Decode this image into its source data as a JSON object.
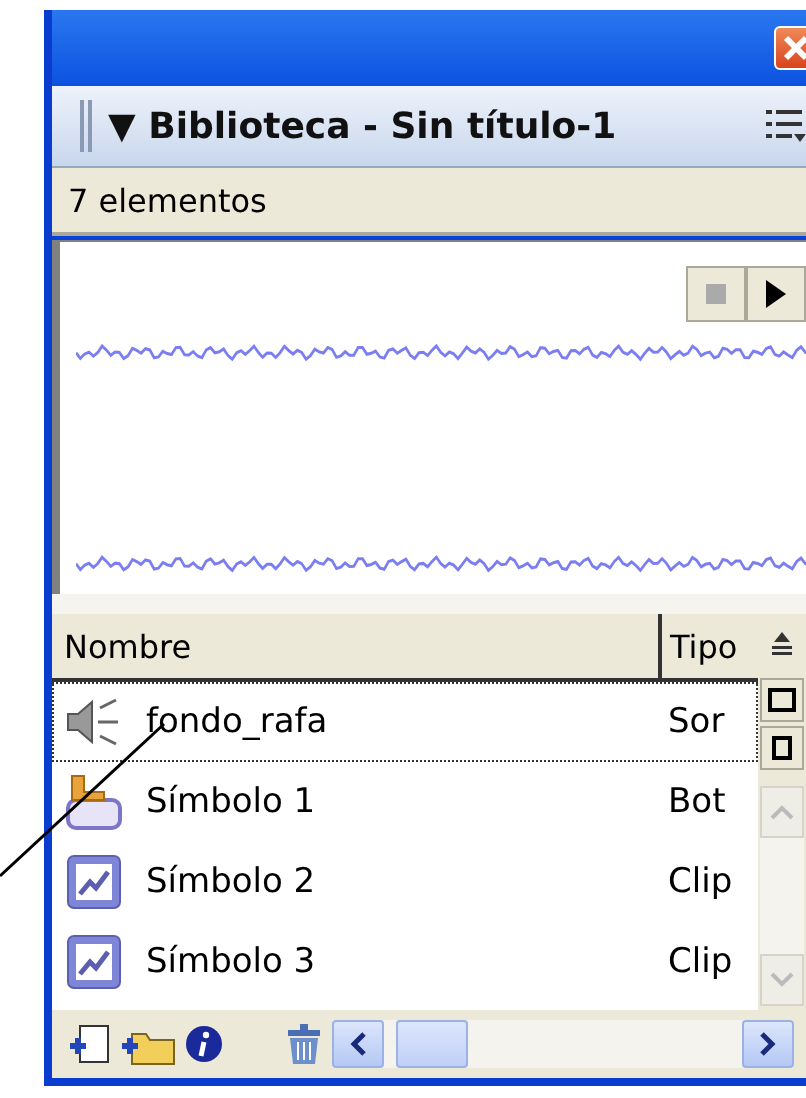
{
  "panel": {
    "title": "▼ Biblioteca - Sin título-1",
    "count": "7 elementos"
  },
  "table": {
    "columns": [
      "Nombre",
      "Tipo"
    ],
    "rows": [
      {
        "name": "fondo_rafa",
        "type": "Sor",
        "kind": "sound",
        "selected": true
      },
      {
        "name": "Símbolo 1",
        "type": "Bot",
        "kind": "button",
        "selected": false
      },
      {
        "name": "Símbolo 2",
        "type": "Clip",
        "kind": "clip",
        "selected": false
      },
      {
        "name": "Símbolo 3",
        "type": "Clip",
        "kind": "clip",
        "selected": false
      }
    ]
  }
}
